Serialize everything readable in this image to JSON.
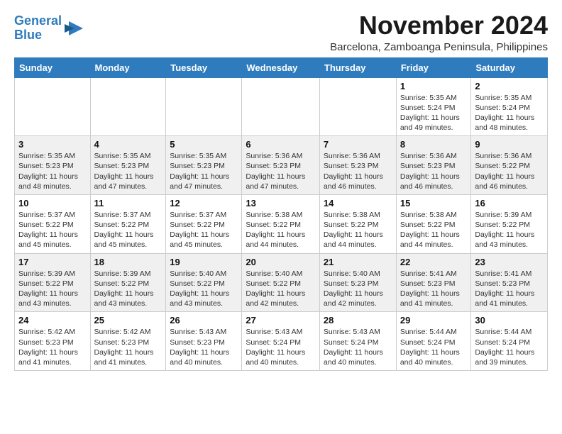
{
  "header": {
    "logo_line1": "General",
    "logo_line2": "Blue",
    "month": "November 2024",
    "location": "Barcelona, Zamboanga Peninsula, Philippines"
  },
  "weekdays": [
    "Sunday",
    "Monday",
    "Tuesday",
    "Wednesday",
    "Thursday",
    "Friday",
    "Saturday"
  ],
  "weeks": [
    [
      {
        "day": "",
        "info": ""
      },
      {
        "day": "",
        "info": ""
      },
      {
        "day": "",
        "info": ""
      },
      {
        "day": "",
        "info": ""
      },
      {
        "day": "",
        "info": ""
      },
      {
        "day": "1",
        "info": "Sunrise: 5:35 AM\nSunset: 5:24 PM\nDaylight: 11 hours and 49 minutes."
      },
      {
        "day": "2",
        "info": "Sunrise: 5:35 AM\nSunset: 5:24 PM\nDaylight: 11 hours and 48 minutes."
      }
    ],
    [
      {
        "day": "3",
        "info": "Sunrise: 5:35 AM\nSunset: 5:23 PM\nDaylight: 11 hours and 48 minutes."
      },
      {
        "day": "4",
        "info": "Sunrise: 5:35 AM\nSunset: 5:23 PM\nDaylight: 11 hours and 47 minutes."
      },
      {
        "day": "5",
        "info": "Sunrise: 5:35 AM\nSunset: 5:23 PM\nDaylight: 11 hours and 47 minutes."
      },
      {
        "day": "6",
        "info": "Sunrise: 5:36 AM\nSunset: 5:23 PM\nDaylight: 11 hours and 47 minutes."
      },
      {
        "day": "7",
        "info": "Sunrise: 5:36 AM\nSunset: 5:23 PM\nDaylight: 11 hours and 46 minutes."
      },
      {
        "day": "8",
        "info": "Sunrise: 5:36 AM\nSunset: 5:23 PM\nDaylight: 11 hours and 46 minutes."
      },
      {
        "day": "9",
        "info": "Sunrise: 5:36 AM\nSunset: 5:22 PM\nDaylight: 11 hours and 46 minutes."
      }
    ],
    [
      {
        "day": "10",
        "info": "Sunrise: 5:37 AM\nSunset: 5:22 PM\nDaylight: 11 hours and 45 minutes."
      },
      {
        "day": "11",
        "info": "Sunrise: 5:37 AM\nSunset: 5:22 PM\nDaylight: 11 hours and 45 minutes."
      },
      {
        "day": "12",
        "info": "Sunrise: 5:37 AM\nSunset: 5:22 PM\nDaylight: 11 hours and 45 minutes."
      },
      {
        "day": "13",
        "info": "Sunrise: 5:38 AM\nSunset: 5:22 PM\nDaylight: 11 hours and 44 minutes."
      },
      {
        "day": "14",
        "info": "Sunrise: 5:38 AM\nSunset: 5:22 PM\nDaylight: 11 hours and 44 minutes."
      },
      {
        "day": "15",
        "info": "Sunrise: 5:38 AM\nSunset: 5:22 PM\nDaylight: 11 hours and 44 minutes."
      },
      {
        "day": "16",
        "info": "Sunrise: 5:39 AM\nSunset: 5:22 PM\nDaylight: 11 hours and 43 minutes."
      }
    ],
    [
      {
        "day": "17",
        "info": "Sunrise: 5:39 AM\nSunset: 5:22 PM\nDaylight: 11 hours and 43 minutes."
      },
      {
        "day": "18",
        "info": "Sunrise: 5:39 AM\nSunset: 5:22 PM\nDaylight: 11 hours and 43 minutes."
      },
      {
        "day": "19",
        "info": "Sunrise: 5:40 AM\nSunset: 5:22 PM\nDaylight: 11 hours and 43 minutes."
      },
      {
        "day": "20",
        "info": "Sunrise: 5:40 AM\nSunset: 5:22 PM\nDaylight: 11 hours and 42 minutes."
      },
      {
        "day": "21",
        "info": "Sunrise: 5:40 AM\nSunset: 5:23 PM\nDaylight: 11 hours and 42 minutes."
      },
      {
        "day": "22",
        "info": "Sunrise: 5:41 AM\nSunset: 5:23 PM\nDaylight: 11 hours and 41 minutes."
      },
      {
        "day": "23",
        "info": "Sunrise: 5:41 AM\nSunset: 5:23 PM\nDaylight: 11 hours and 41 minutes."
      }
    ],
    [
      {
        "day": "24",
        "info": "Sunrise: 5:42 AM\nSunset: 5:23 PM\nDaylight: 11 hours and 41 minutes."
      },
      {
        "day": "25",
        "info": "Sunrise: 5:42 AM\nSunset: 5:23 PM\nDaylight: 11 hours and 41 minutes."
      },
      {
        "day": "26",
        "info": "Sunrise: 5:43 AM\nSunset: 5:23 PM\nDaylight: 11 hours and 40 minutes."
      },
      {
        "day": "27",
        "info": "Sunrise: 5:43 AM\nSunset: 5:24 PM\nDaylight: 11 hours and 40 minutes."
      },
      {
        "day": "28",
        "info": "Sunrise: 5:43 AM\nSunset: 5:24 PM\nDaylight: 11 hours and 40 minutes."
      },
      {
        "day": "29",
        "info": "Sunrise: 5:44 AM\nSunset: 5:24 PM\nDaylight: 11 hours and 40 minutes."
      },
      {
        "day": "30",
        "info": "Sunrise: 5:44 AM\nSunset: 5:24 PM\nDaylight: 11 hours and 39 minutes."
      }
    ]
  ]
}
